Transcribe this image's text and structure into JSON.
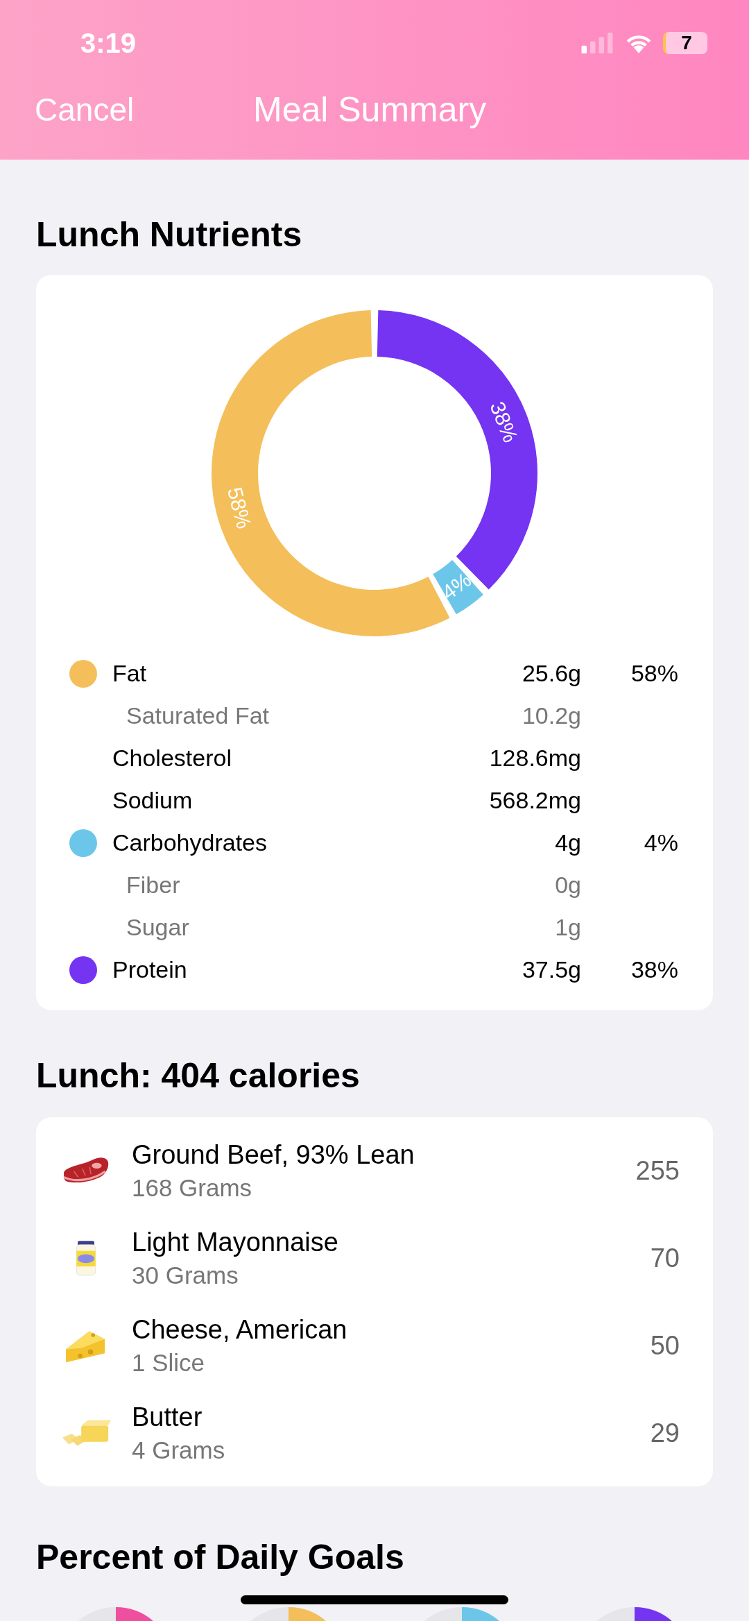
{
  "status_bar": {
    "time": "3:19",
    "battery": "7"
  },
  "nav": {
    "cancel": "Cancel",
    "title": "Meal Summary"
  },
  "nutrients": {
    "heading": "Lunch Nutrients",
    "chart_data": {
      "type": "donut",
      "categories": [
        "Fat",
        "Carbohydrates",
        "Protein"
      ],
      "values": [
        58,
        4,
        38
      ],
      "colors": [
        "#f4bf5a",
        "#6cc6ea",
        "#7434f2"
      ],
      "value_labels": [
        "58%",
        "4%",
        "38%"
      ]
    },
    "rows": [
      {
        "kind": "nutrient",
        "amount": "25.6g",
        "percent": "58%"
      },
      {
        "kind": "sub",
        "name": "Saturated Fat",
        "amount": "10.2g"
      },
      {
        "kind": "plain",
        "name": "Cholesterol",
        "amount": "128.6mg"
      },
      {
        "kind": "plain",
        "name": "Sodium",
        "amount": "568.2mg"
      },
      {
        "kind": "nutrient",
        "amount": "4g",
        "percent": "4%"
      },
      {
        "kind": "sub",
        "name": "Fiber",
        "amount": "0g"
      },
      {
        "kind": "sub",
        "name": "Sugar",
        "amount": "1g"
      },
      {
        "kind": "nutrient",
        "amount": "37.5g",
        "percent": "38%"
      }
    ]
  },
  "meal": {
    "heading": "Lunch: 404 calories",
    "foods": [
      {
        "kind": "steak",
        "name": "Ground Beef, 93% Lean",
        "serving": "168 Grams",
        "calories": "255"
      },
      {
        "kind": "jar",
        "name": "Light Mayonnaise",
        "serving": "30 Grams",
        "calories": "70"
      },
      {
        "kind": "cheese",
        "name": "Cheese, American",
        "serving": "1 Slice",
        "calories": "50"
      },
      {
        "kind": "butter",
        "name": "Butter",
        "serving": "4 Grams",
        "calories": "29"
      }
    ]
  },
  "goals": {
    "heading": "Percent of Daily Goals",
    "rings": [
      {
        "color": "#ee4f9f"
      },
      {
        "color": "#f4bf5a"
      },
      {
        "color": "#6cc6ea"
      },
      {
        "color": "#7434f2"
      }
    ]
  }
}
